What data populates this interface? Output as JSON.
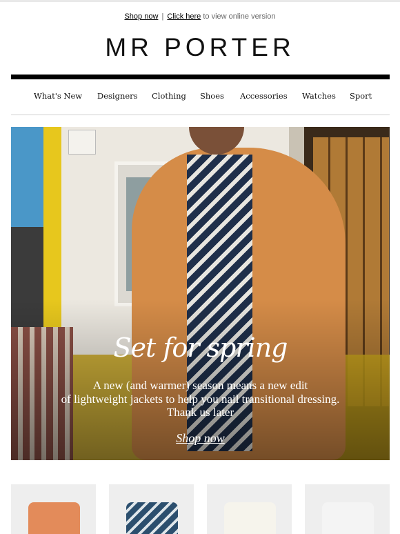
{
  "preheader": {
    "shop_now": "Shop now",
    "separator": "|",
    "click_here": "Click here",
    "rest": "to view online version"
  },
  "brand": {
    "logo": "MR PORTER"
  },
  "nav": {
    "items": [
      {
        "label": "What's New"
      },
      {
        "label": "Designers"
      },
      {
        "label": "Clothing"
      },
      {
        "label": "Shoes"
      },
      {
        "label": "Accessories"
      },
      {
        "label": "Watches"
      },
      {
        "label": "Sport"
      }
    ]
  },
  "hero": {
    "headline": "Set for spring",
    "copy_line1": "A new (and warmer) season means a new edit",
    "copy_line2": "of lightweight jackets to help you nail transitional dressing.",
    "copy_line3": "Thank us later",
    "cta": "Shop now"
  },
  "products": [
    {
      "icon": "orange-jacket",
      "color": "#e38b5a"
    },
    {
      "icon": "patterned-shirt",
      "color": "#2c4f6e"
    },
    {
      "icon": "cream-trousers",
      "color": "#f1efe6"
    },
    {
      "icon": "grey-item",
      "color": "#f4f4f4"
    }
  ]
}
